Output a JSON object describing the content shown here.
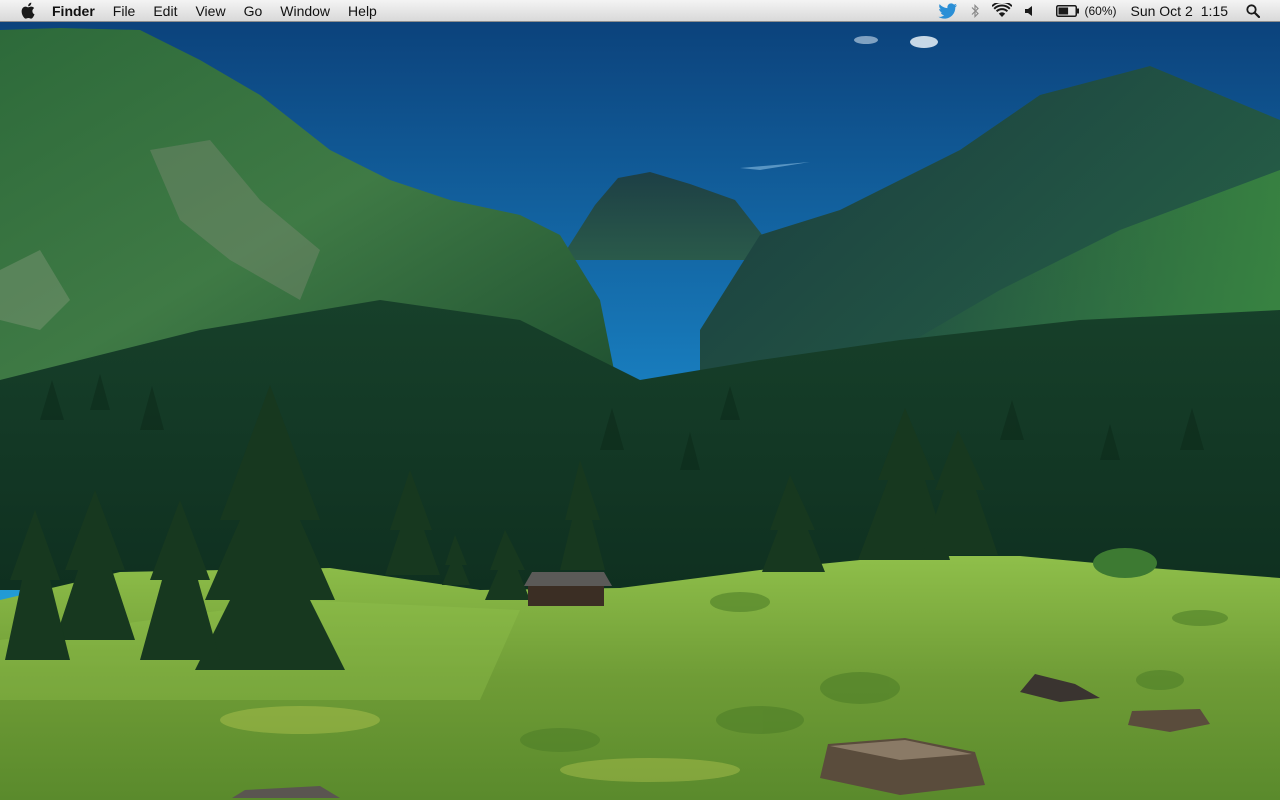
{
  "menubar": {
    "app_name": "Finder",
    "menus": [
      "File",
      "Edit",
      "View",
      "Go",
      "Window",
      "Help"
    ],
    "status_icons": [
      "twitter-bird-icon",
      "bluetooth-icon",
      "wifi-icon",
      "volume-icon",
      "battery-icon",
      "spotlight-search-icon"
    ],
    "battery_text": "(60%)",
    "battery_level": 0.6,
    "date_text": "Sun Oct 2",
    "time_text": "1:15"
  },
  "desktop": {
    "wallpaper": "alpine-valley-meadow",
    "colors": {
      "sky_top": "#0d4a82",
      "sky_horizon": "#2ab4e8",
      "forest": "#1f5a2c",
      "meadow": "#7fae3c",
      "twitter_blue": "#2b8fd6"
    }
  }
}
